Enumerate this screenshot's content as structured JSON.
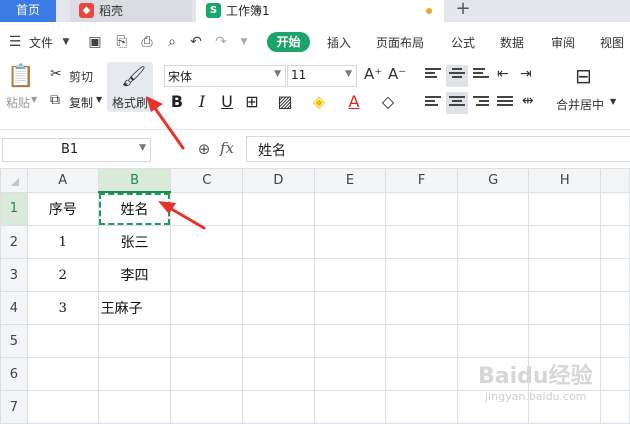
{
  "tabs": {
    "home": "首页",
    "daoke": "稻壳",
    "workbook": "工作簿1",
    "add": "+"
  },
  "menu": {
    "file": "文件",
    "start": "开始",
    "items": [
      "插入",
      "页面布局",
      "公式",
      "数据",
      "审阅",
      "视图"
    ]
  },
  "ribbon": {
    "cut": "剪切",
    "copy": "复制",
    "paste": "粘贴",
    "format_painter": "格式刷",
    "font_name": "宋体",
    "font_size": "11",
    "merge_center": "合并居中"
  },
  "formula_bar": {
    "name_box": "B1",
    "fx": "fx",
    "value": "姓名"
  },
  "sheet": {
    "columns": [
      "A",
      "B",
      "C",
      "D",
      "E",
      "F",
      "G",
      "H"
    ],
    "selected_column": "B",
    "selected_cell": "B1",
    "rows": [
      {
        "num": "1",
        "cells": [
          "序号",
          "姓名",
          "",
          "",
          "",
          "",
          "",
          ""
        ]
      },
      {
        "num": "2",
        "cells": [
          "1",
          "张三",
          "",
          "",
          "",
          "",
          "",
          ""
        ]
      },
      {
        "num": "3",
        "cells": [
          "2",
          "李四",
          "",
          "",
          "",
          "",
          "",
          ""
        ]
      },
      {
        "num": "4",
        "cells": [
          "3",
          "王麻子",
          "",
          "",
          "",
          "",
          "",
          ""
        ]
      },
      {
        "num": "5",
        "cells": [
          "",
          "",
          "",
          "",
          "",
          "",
          "",
          ""
        ]
      },
      {
        "num": "6",
        "cells": [
          "",
          "",
          "",
          "",
          "",
          "",
          "",
          ""
        ]
      },
      {
        "num": "7",
        "cells": [
          "",
          "",
          "",
          "",
          "",
          "",
          "",
          ""
        ]
      }
    ]
  },
  "watermark": {
    "text": "Baidu经验",
    "sub": "jingyan.baidu.com"
  },
  "colors": {
    "brand_green": "#1ca36a",
    "tab_blue": "#3b7be6",
    "arrow_red": "#e8322f"
  }
}
